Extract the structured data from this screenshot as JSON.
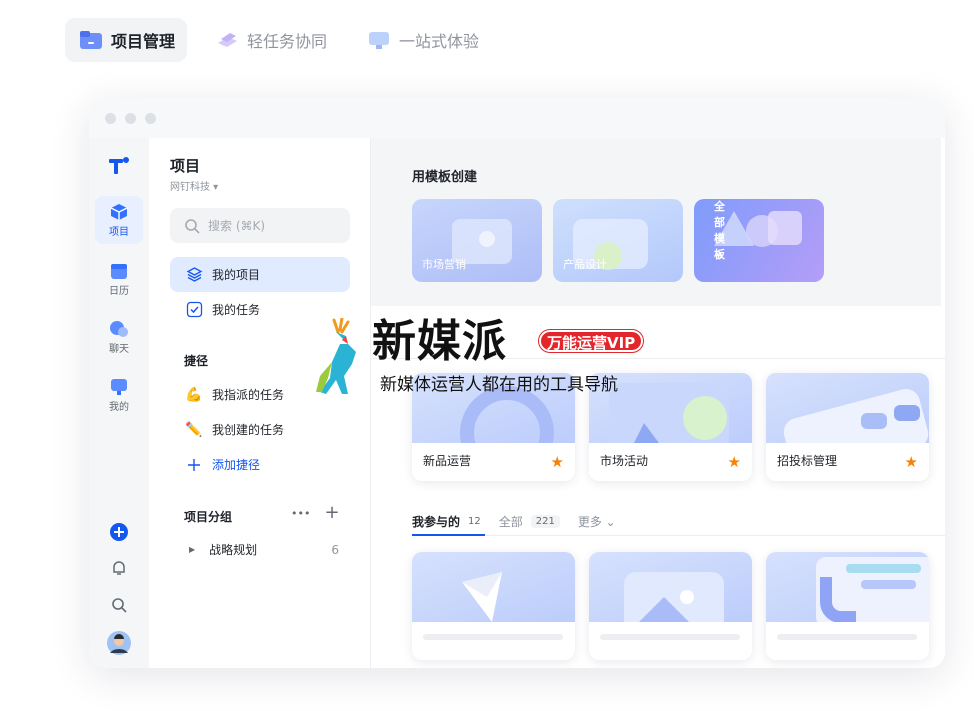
{
  "top_tabs": [
    {
      "label": "项目管理",
      "active": true
    },
    {
      "label": "轻任务协同",
      "active": false
    },
    {
      "label": "一站式体验",
      "active": false
    }
  ],
  "rail": {
    "items": [
      {
        "label": "项目",
        "icon": "cube-icon",
        "active": true
      },
      {
        "label": "日历",
        "icon": "calendar-icon"
      },
      {
        "label": "聊天",
        "icon": "chat-icon"
      },
      {
        "label": "我的",
        "icon": "profile-icon"
      }
    ]
  },
  "side": {
    "title": "项目",
    "org": "网钉科技 ▾",
    "search_placeholder": "搜索 (⌘K)",
    "nav": [
      {
        "label": "我的项目",
        "icon": "layers-icon",
        "active": true
      },
      {
        "label": "我的任务",
        "icon": "checkbox-icon"
      }
    ],
    "shortcuts_heading": "捷径",
    "shortcuts": [
      {
        "label": "我指派的任务",
        "icon": "flex-arm-icon"
      },
      {
        "label": "我创建的任务",
        "icon": "pencil-icon"
      }
    ],
    "add_shortcut": "添加捷径",
    "groups_heading": "项目分组",
    "group_more": "•••",
    "group_add": "+",
    "groups": [
      {
        "label": "战略规划",
        "count": "6"
      }
    ]
  },
  "content": {
    "templates_heading": "用模板创建",
    "templates": [
      {
        "label": "市场营销"
      },
      {
        "label": "产品设计"
      },
      {
        "label": "探索全部模板",
        "arrow": "→"
      }
    ],
    "starred": [
      {
        "label": "新品运营"
      },
      {
        "label": "市场活动"
      },
      {
        "label": "招投标管理"
      }
    ],
    "tabs": [
      {
        "label": "我参与的",
        "count": "12",
        "active": true
      },
      {
        "label": "全部",
        "count": "221"
      },
      {
        "label": "更多 ⌄"
      }
    ]
  },
  "watermark": {
    "title": "新媒派",
    "vip": "万能运营VIP",
    "subtitle": "新媒体运营人都在用的工具导航"
  },
  "colors": {
    "accent": "#1456f0",
    "star": "#f5820b",
    "vip": "#e3262b"
  }
}
